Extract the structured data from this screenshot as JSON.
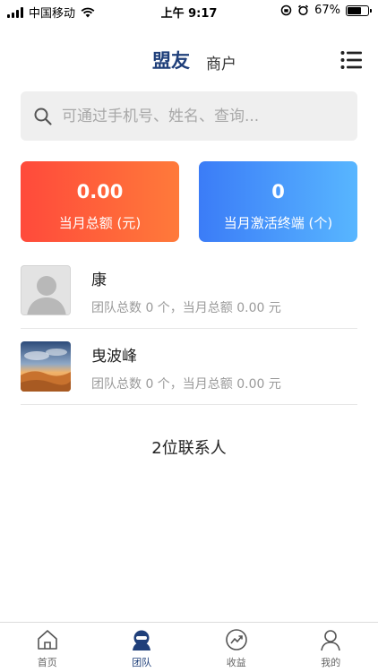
{
  "status_bar": {
    "carrier": "中国移动",
    "time": "上午 9:17",
    "battery": "67%",
    "battery_level": 0.67
  },
  "header": {
    "tab_active": "盟友",
    "tab_inactive": "商户",
    "menu_icon": "list-icon"
  },
  "search": {
    "placeholder": "可通过手机号、姓名、查询..."
  },
  "stats": {
    "monthly_total_value": "0.00",
    "monthly_total_label": "当月总额 (元)",
    "activated_value": "0",
    "activated_label": "当月激活终端 (个)"
  },
  "contacts": [
    {
      "name": "康",
      "info": "团队总数 0 个，当月总额 0.00 元",
      "avatar": "default-avatar"
    },
    {
      "name": "曳波峰",
      "info": "团队总数 0 个，当月总额 0.00 元",
      "avatar": "desert-photo"
    }
  ],
  "contact_count": "2位联系人",
  "tabbar": {
    "items": [
      {
        "label": "首页",
        "icon": "home-icon",
        "active": false
      },
      {
        "label": "团队",
        "icon": "team-icon",
        "active": true
      },
      {
        "label": "收益",
        "icon": "earnings-icon",
        "active": false
      },
      {
        "label": "我的",
        "icon": "profile-icon",
        "active": false
      }
    ]
  },
  "colors": {
    "brand": "#1f3f7a",
    "card_red_start": "#ff4a3b",
    "card_red_end": "#ff7a3a",
    "card_blue_start": "#3b7cf7",
    "card_blue_end": "#58b6ff"
  }
}
